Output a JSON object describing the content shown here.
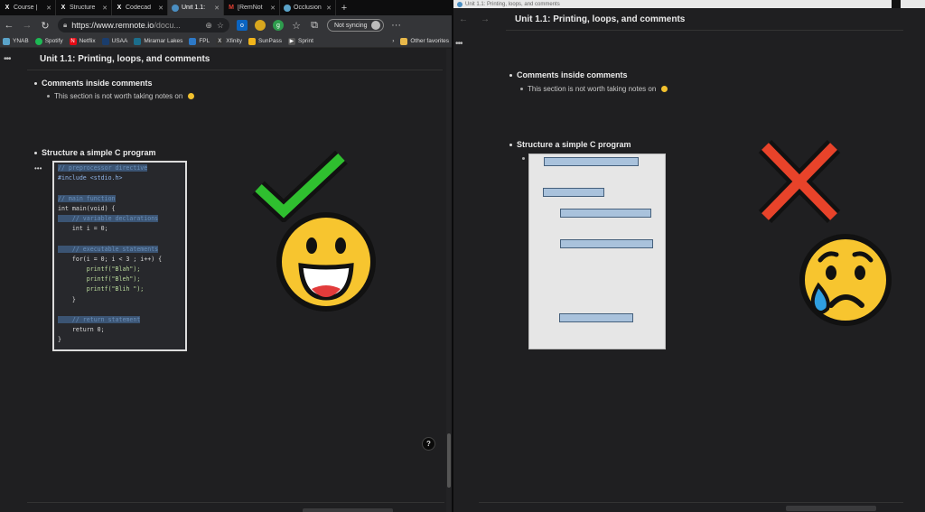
{
  "browser": {
    "tabs": [
      {
        "label": "Course |",
        "icon": "x-logo-icon",
        "active": false
      },
      {
        "label": "Structure",
        "icon": "x-logo-icon",
        "active": false
      },
      {
        "label": "Codecad",
        "icon": "x-logo-icon",
        "active": false
      },
      {
        "label": "Unit 1.1:",
        "icon": "remnote-icon",
        "active": true
      },
      {
        "label": "[RemNot",
        "icon": "gmail-icon",
        "active": false
      },
      {
        "label": "Occlusion",
        "icon": "globe-icon",
        "active": false
      }
    ],
    "new_tab": "+",
    "url_main": "https://www.remnote.io",
    "url_rest": "/docu...",
    "sync_label": "Not syncing",
    "more": "···",
    "bookmarks": [
      {
        "label": "YNAB",
        "color": "#5aa3c9"
      },
      {
        "label": "Spotify",
        "color": "#1db954"
      },
      {
        "label": "Netflix",
        "color": "#e50914"
      },
      {
        "label": "USAA",
        "color": "#1a3d6d"
      },
      {
        "label": "Miramar Lakes",
        "color": "#1c6e8c"
      },
      {
        "label": "FPL",
        "color": "#2d79c7"
      },
      {
        "label": "Xfinity",
        "color": "#333333"
      },
      {
        "label": "SunPass",
        "color": "#f2b51b"
      },
      {
        "label": "Sprint",
        "color": "#555555"
      }
    ],
    "bookmarks_more": "›",
    "other_favorites": "Other favorites"
  },
  "left_page": {
    "title": "Unit 1.1: Printing, loops, and comments",
    "section1": "Comments inside comments",
    "section1_note": "This section is not worth taking notes on",
    "section2": "Structure a simple C program",
    "code_lines": [
      "// preprocessor directive",
      "#include <stdio.h>",
      "",
      "// main function",
      "int main(void) {",
      "    // variable declarations",
      "    int i = 0;",
      "",
      "    // executable statements",
      "    for(i = 0; i < 3 ; i++) {",
      "        printf(\"Blah\");",
      "        printf(\"Bleh\");",
      "        printf(\"Blih \");",
      "    }",
      "",
      "    // return statement",
      "    return 0;",
      "}"
    ],
    "help": "?"
  },
  "right_page": {
    "window_title": "Unit 1.1: Printing, loops, and comments",
    "title": "Unit 1.1: Printing, loops, and comments",
    "section1": "Comments inside comments",
    "section1_note": "This section is not worth taking notes on",
    "section2": "Structure a simple C program"
  },
  "colors": {
    "check": "#2fbf2f",
    "cross": "#e8432a",
    "emoji": "#f7c52f",
    "occlusion_box": "#a9c2dc"
  }
}
